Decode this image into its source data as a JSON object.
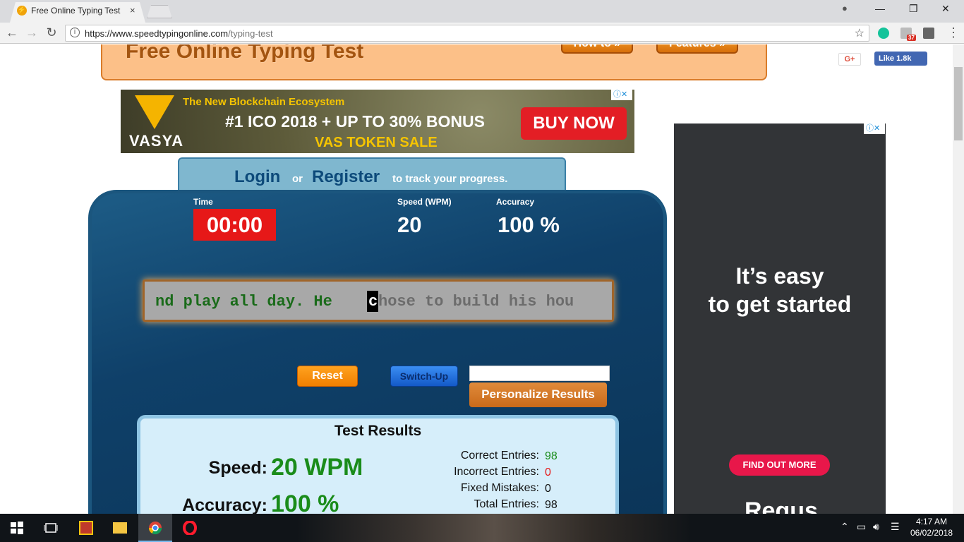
{
  "browser": {
    "tab_title": "Free Online Typing Test -",
    "tab_close": "×",
    "window_controls": {
      "minimize": "—",
      "restore": "❐",
      "close": "✕",
      "account": "●"
    },
    "url_secure": "https://www.speedtypingonline.com",
    "url_path": "/typing-test",
    "extension_badge": "37",
    "menu": "⋮"
  },
  "header": {
    "title": "Free Online Typing Test",
    "how_to": "How to »",
    "features": "Features »",
    "gplus": "G+",
    "fb_like": "Like 1.8k"
  },
  "ad_top": {
    "line1": "The New Blockchain Ecosystem",
    "line2": "#1 ICO 2018  + UP TO 30% BONUS",
    "line3": "VAS TOKEN SALE",
    "button": "BUY NOW",
    "brand": "VASYA",
    "adchoices": "ⓘ✕"
  },
  "login_bar": {
    "login": "Login",
    "or": "or",
    "register": "Register",
    "suffix": "to track your progress."
  },
  "stats": {
    "time_label": "Time",
    "time_value": "00:00",
    "speed_label": "Speed (WPM)",
    "speed_value": "20",
    "accuracy_label": "Accuracy",
    "accuracy_value": "100 %"
  },
  "typing": {
    "typed": "nd play all day. He ",
    "cursor_char": "c",
    "untyped": "hose to build his hou"
  },
  "controls": {
    "reset": "Reset",
    "switch_up": "Switch-Up",
    "personalize": "Personalize Results",
    "name_input_value": ""
  },
  "results": {
    "title": "Test Results",
    "speed_label": "Speed:",
    "speed_value": "20 WPM",
    "accuracy_label": "Accuracy:",
    "accuracy_value": "100 %",
    "correct_label": "Correct Entries:",
    "correct_value": "98",
    "incorrect_label": "Incorrect Entries:",
    "incorrect_value": "0",
    "fixed_label": "Fixed Mistakes:",
    "fixed_value": "0",
    "total_label": "Total Entries:",
    "total_value": "98"
  },
  "ad_right": {
    "headline1": "It’s easy",
    "headline2": "to get started",
    "cta": "FIND OUT MORE",
    "brand": "Regus",
    "adchoices": "ⓘ✕"
  },
  "taskbar": {
    "time": "4:17 AM",
    "date": "06/02/2018"
  },
  "colors": {
    "accent_orange": "#fcc088",
    "panel_blue": "#0f4069",
    "timer_red": "#e61818",
    "result_green": "#1a8c1a"
  }
}
